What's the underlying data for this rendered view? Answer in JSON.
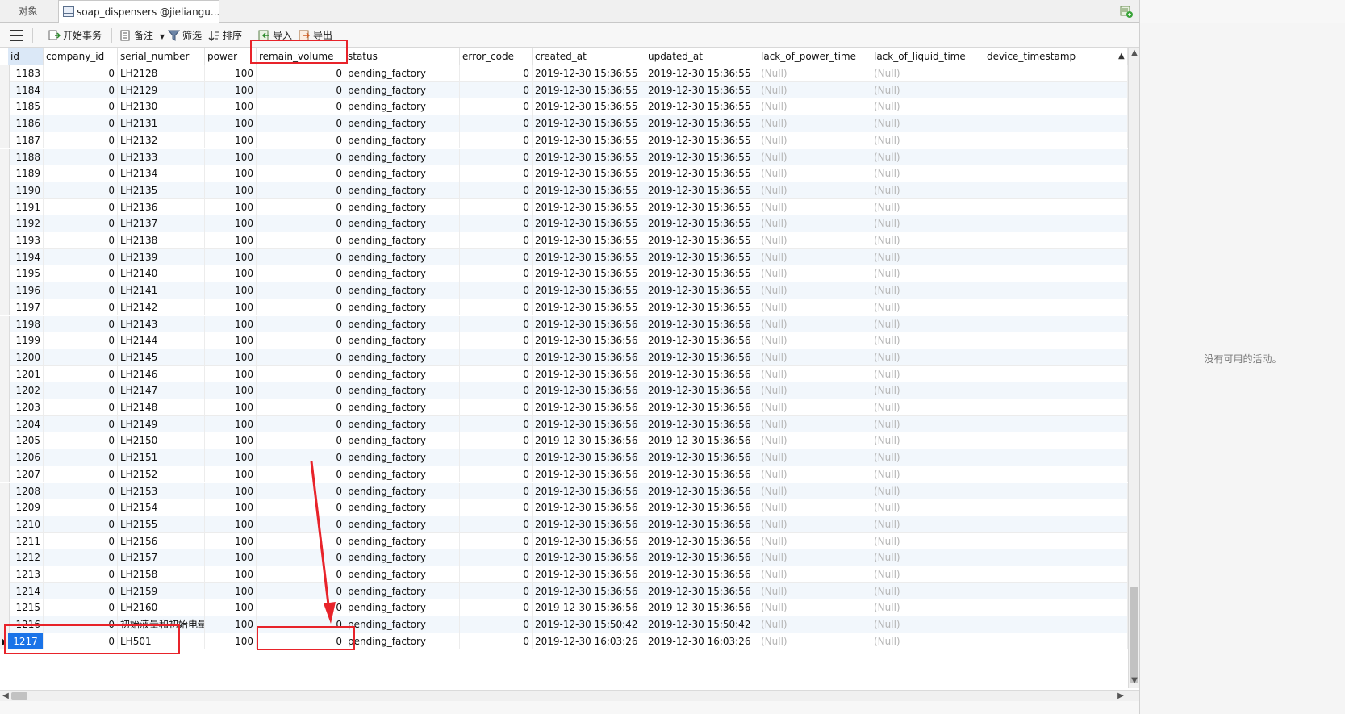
{
  "tabs": {
    "objects_label": "对象",
    "table_tab_label": "soap_dispensers @jieliangu..."
  },
  "toolbar": {
    "begin_transaction": "开始事务",
    "memo": "备注",
    "filter": "筛选",
    "sort": "排序",
    "import": "导入",
    "export": "导出"
  },
  "columns": [
    "id",
    "company_id",
    "serial_number",
    "power",
    "remain_volume",
    "status",
    "error_code",
    "created_at",
    "updated_at",
    "lack_of_power_time",
    "lack_of_liquid_time",
    "device_timestamp"
  ],
  "rows": [
    {
      "id": "1183",
      "company_id": "0",
      "serial_number": "LH2128",
      "power": "100",
      "remain_volume": "0",
      "status": "pending_factory",
      "error_code": "0",
      "created_at": "2019-12-30 15:36:55",
      "updated_at": "2019-12-30 15:36:55",
      "lack_of_power_time": "(Null)",
      "lack_of_liquid_time": "(Null)"
    },
    {
      "id": "1184",
      "company_id": "0",
      "serial_number": "LH2129",
      "power": "100",
      "remain_volume": "0",
      "status": "pending_factory",
      "error_code": "0",
      "created_at": "2019-12-30 15:36:55",
      "updated_at": "2019-12-30 15:36:55",
      "lack_of_power_time": "(Null)",
      "lack_of_liquid_time": "(Null)"
    },
    {
      "id": "1185",
      "company_id": "0",
      "serial_number": "LH2130",
      "power": "100",
      "remain_volume": "0",
      "status": "pending_factory",
      "error_code": "0",
      "created_at": "2019-12-30 15:36:55",
      "updated_at": "2019-12-30 15:36:55",
      "lack_of_power_time": "(Null)",
      "lack_of_liquid_time": "(Null)"
    },
    {
      "id": "1186",
      "company_id": "0",
      "serial_number": "LH2131",
      "power": "100",
      "remain_volume": "0",
      "status": "pending_factory",
      "error_code": "0",
      "created_at": "2019-12-30 15:36:55",
      "updated_at": "2019-12-30 15:36:55",
      "lack_of_power_time": "(Null)",
      "lack_of_liquid_time": "(Null)"
    },
    {
      "id": "1187",
      "company_id": "0",
      "serial_number": "LH2132",
      "power": "100",
      "remain_volume": "0",
      "status": "pending_factory",
      "error_code": "0",
      "created_at": "2019-12-30 15:36:55",
      "updated_at": "2019-12-30 15:36:55",
      "lack_of_power_time": "(Null)",
      "lack_of_liquid_time": "(Null)"
    },
    {
      "id": "1188",
      "company_id": "0",
      "serial_number": "LH2133",
      "power": "100",
      "remain_volume": "0",
      "status": "pending_factory",
      "error_code": "0",
      "created_at": "2019-12-30 15:36:55",
      "updated_at": "2019-12-30 15:36:55",
      "lack_of_power_time": "(Null)",
      "lack_of_liquid_time": "(Null)"
    },
    {
      "id": "1189",
      "company_id": "0",
      "serial_number": "LH2134",
      "power": "100",
      "remain_volume": "0",
      "status": "pending_factory",
      "error_code": "0",
      "created_at": "2019-12-30 15:36:55",
      "updated_at": "2019-12-30 15:36:55",
      "lack_of_power_time": "(Null)",
      "lack_of_liquid_time": "(Null)"
    },
    {
      "id": "1190",
      "company_id": "0",
      "serial_number": "LH2135",
      "power": "100",
      "remain_volume": "0",
      "status": "pending_factory",
      "error_code": "0",
      "created_at": "2019-12-30 15:36:55",
      "updated_at": "2019-12-30 15:36:55",
      "lack_of_power_time": "(Null)",
      "lack_of_liquid_time": "(Null)"
    },
    {
      "id": "1191",
      "company_id": "0",
      "serial_number": "LH2136",
      "power": "100",
      "remain_volume": "0",
      "status": "pending_factory",
      "error_code": "0",
      "created_at": "2019-12-30 15:36:55",
      "updated_at": "2019-12-30 15:36:55",
      "lack_of_power_time": "(Null)",
      "lack_of_liquid_time": "(Null)"
    },
    {
      "id": "1192",
      "company_id": "0",
      "serial_number": "LH2137",
      "power": "100",
      "remain_volume": "0",
      "status": "pending_factory",
      "error_code": "0",
      "created_at": "2019-12-30 15:36:55",
      "updated_at": "2019-12-30 15:36:55",
      "lack_of_power_time": "(Null)",
      "lack_of_liquid_time": "(Null)"
    },
    {
      "id": "1193",
      "company_id": "0",
      "serial_number": "LH2138",
      "power": "100",
      "remain_volume": "0",
      "status": "pending_factory",
      "error_code": "0",
      "created_at": "2019-12-30 15:36:55",
      "updated_at": "2019-12-30 15:36:55",
      "lack_of_power_time": "(Null)",
      "lack_of_liquid_time": "(Null)"
    },
    {
      "id": "1194",
      "company_id": "0",
      "serial_number": "LH2139",
      "power": "100",
      "remain_volume": "0",
      "status": "pending_factory",
      "error_code": "0",
      "created_at": "2019-12-30 15:36:55",
      "updated_at": "2019-12-30 15:36:55",
      "lack_of_power_time": "(Null)",
      "lack_of_liquid_time": "(Null)"
    },
    {
      "id": "1195",
      "company_id": "0",
      "serial_number": "LH2140",
      "power": "100",
      "remain_volume": "0",
      "status": "pending_factory",
      "error_code": "0",
      "created_at": "2019-12-30 15:36:55",
      "updated_at": "2019-12-30 15:36:55",
      "lack_of_power_time": "(Null)",
      "lack_of_liquid_time": "(Null)"
    },
    {
      "id": "1196",
      "company_id": "0",
      "serial_number": "LH2141",
      "power": "100",
      "remain_volume": "0",
      "status": "pending_factory",
      "error_code": "0",
      "created_at": "2019-12-30 15:36:55",
      "updated_at": "2019-12-30 15:36:55",
      "lack_of_power_time": "(Null)",
      "lack_of_liquid_time": "(Null)"
    },
    {
      "id": "1197",
      "company_id": "0",
      "serial_number": "LH2142",
      "power": "100",
      "remain_volume": "0",
      "status": "pending_factory",
      "error_code": "0",
      "created_at": "2019-12-30 15:36:55",
      "updated_at": "2019-12-30 15:36:55",
      "lack_of_power_time": "(Null)",
      "lack_of_liquid_time": "(Null)"
    },
    {
      "id": "1198",
      "company_id": "0",
      "serial_number": "LH2143",
      "power": "100",
      "remain_volume": "0",
      "status": "pending_factory",
      "error_code": "0",
      "created_at": "2019-12-30 15:36:56",
      "updated_at": "2019-12-30 15:36:56",
      "lack_of_power_time": "(Null)",
      "lack_of_liquid_time": "(Null)"
    },
    {
      "id": "1199",
      "company_id": "0",
      "serial_number": "LH2144",
      "power": "100",
      "remain_volume": "0",
      "status": "pending_factory",
      "error_code": "0",
      "created_at": "2019-12-30 15:36:56",
      "updated_at": "2019-12-30 15:36:56",
      "lack_of_power_time": "(Null)",
      "lack_of_liquid_time": "(Null)"
    },
    {
      "id": "1200",
      "company_id": "0",
      "serial_number": "LH2145",
      "power": "100",
      "remain_volume": "0",
      "status": "pending_factory",
      "error_code": "0",
      "created_at": "2019-12-30 15:36:56",
      "updated_at": "2019-12-30 15:36:56",
      "lack_of_power_time": "(Null)",
      "lack_of_liquid_time": "(Null)"
    },
    {
      "id": "1201",
      "company_id": "0",
      "serial_number": "LH2146",
      "power": "100",
      "remain_volume": "0",
      "status": "pending_factory",
      "error_code": "0",
      "created_at": "2019-12-30 15:36:56",
      "updated_at": "2019-12-30 15:36:56",
      "lack_of_power_time": "(Null)",
      "lack_of_liquid_time": "(Null)"
    },
    {
      "id": "1202",
      "company_id": "0",
      "serial_number": "LH2147",
      "power": "100",
      "remain_volume": "0",
      "status": "pending_factory",
      "error_code": "0",
      "created_at": "2019-12-30 15:36:56",
      "updated_at": "2019-12-30 15:36:56",
      "lack_of_power_time": "(Null)",
      "lack_of_liquid_time": "(Null)"
    },
    {
      "id": "1203",
      "company_id": "0",
      "serial_number": "LH2148",
      "power": "100",
      "remain_volume": "0",
      "status": "pending_factory",
      "error_code": "0",
      "created_at": "2019-12-30 15:36:56",
      "updated_at": "2019-12-30 15:36:56",
      "lack_of_power_time": "(Null)",
      "lack_of_liquid_time": "(Null)"
    },
    {
      "id": "1204",
      "company_id": "0",
      "serial_number": "LH2149",
      "power": "100",
      "remain_volume": "0",
      "status": "pending_factory",
      "error_code": "0",
      "created_at": "2019-12-30 15:36:56",
      "updated_at": "2019-12-30 15:36:56",
      "lack_of_power_time": "(Null)",
      "lack_of_liquid_time": "(Null)"
    },
    {
      "id": "1205",
      "company_id": "0",
      "serial_number": "LH2150",
      "power": "100",
      "remain_volume": "0",
      "status": "pending_factory",
      "error_code": "0",
      "created_at": "2019-12-30 15:36:56",
      "updated_at": "2019-12-30 15:36:56",
      "lack_of_power_time": "(Null)",
      "lack_of_liquid_time": "(Null)"
    },
    {
      "id": "1206",
      "company_id": "0",
      "serial_number": "LH2151",
      "power": "100",
      "remain_volume": "0",
      "status": "pending_factory",
      "error_code": "0",
      "created_at": "2019-12-30 15:36:56",
      "updated_at": "2019-12-30 15:36:56",
      "lack_of_power_time": "(Null)",
      "lack_of_liquid_time": "(Null)"
    },
    {
      "id": "1207",
      "company_id": "0",
      "serial_number": "LH2152",
      "power": "100",
      "remain_volume": "0",
      "status": "pending_factory",
      "error_code": "0",
      "created_at": "2019-12-30 15:36:56",
      "updated_at": "2019-12-30 15:36:56",
      "lack_of_power_time": "(Null)",
      "lack_of_liquid_time": "(Null)"
    },
    {
      "id": "1208",
      "company_id": "0",
      "serial_number": "LH2153",
      "power": "100",
      "remain_volume": "0",
      "status": "pending_factory",
      "error_code": "0",
      "created_at": "2019-12-30 15:36:56",
      "updated_at": "2019-12-30 15:36:56",
      "lack_of_power_time": "(Null)",
      "lack_of_liquid_time": "(Null)"
    },
    {
      "id": "1209",
      "company_id": "0",
      "serial_number": "LH2154",
      "power": "100",
      "remain_volume": "0",
      "status": "pending_factory",
      "error_code": "0",
      "created_at": "2019-12-30 15:36:56",
      "updated_at": "2019-12-30 15:36:56",
      "lack_of_power_time": "(Null)",
      "lack_of_liquid_time": "(Null)"
    },
    {
      "id": "1210",
      "company_id": "0",
      "serial_number": "LH2155",
      "power": "100",
      "remain_volume": "0",
      "status": "pending_factory",
      "error_code": "0",
      "created_at": "2019-12-30 15:36:56",
      "updated_at": "2019-12-30 15:36:56",
      "lack_of_power_time": "(Null)",
      "lack_of_liquid_time": "(Null)"
    },
    {
      "id": "1211",
      "company_id": "0",
      "serial_number": "LH2156",
      "power": "100",
      "remain_volume": "0",
      "status": "pending_factory",
      "error_code": "0",
      "created_at": "2019-12-30 15:36:56",
      "updated_at": "2019-12-30 15:36:56",
      "lack_of_power_time": "(Null)",
      "lack_of_liquid_time": "(Null)"
    },
    {
      "id": "1212",
      "company_id": "0",
      "serial_number": "LH2157",
      "power": "100",
      "remain_volume": "0",
      "status": "pending_factory",
      "error_code": "0",
      "created_at": "2019-12-30 15:36:56",
      "updated_at": "2019-12-30 15:36:56",
      "lack_of_power_time": "(Null)",
      "lack_of_liquid_time": "(Null)"
    },
    {
      "id": "1213",
      "company_id": "0",
      "serial_number": "LH2158",
      "power": "100",
      "remain_volume": "0",
      "status": "pending_factory",
      "error_code": "0",
      "created_at": "2019-12-30 15:36:56",
      "updated_at": "2019-12-30 15:36:56",
      "lack_of_power_time": "(Null)",
      "lack_of_liquid_time": "(Null)"
    },
    {
      "id": "1214",
      "company_id": "0",
      "serial_number": "LH2159",
      "power": "100",
      "remain_volume": "0",
      "status": "pending_factory",
      "error_code": "0",
      "created_at": "2019-12-30 15:36:56",
      "updated_at": "2019-12-30 15:36:56",
      "lack_of_power_time": "(Null)",
      "lack_of_liquid_time": "(Null)"
    },
    {
      "id": "1215",
      "company_id": "0",
      "serial_number": "LH2160",
      "power": "100",
      "remain_volume": "0",
      "status": "pending_factory",
      "error_code": "0",
      "created_at": "2019-12-30 15:36:56",
      "updated_at": "2019-12-30 15:36:56",
      "lack_of_power_time": "(Null)",
      "lack_of_liquid_time": "(Null)"
    },
    {
      "id": "1216",
      "company_id": "0",
      "serial_number": "初始液量和初始电量",
      "power": "100",
      "remain_volume": "0",
      "status": "pending_factory",
      "error_code": "0",
      "created_at": "2019-12-30 15:50:42",
      "updated_at": "2019-12-30 15:50:42",
      "lack_of_power_time": "(Null)",
      "lack_of_liquid_time": "(Null)"
    },
    {
      "id": "1217",
      "company_id": "0",
      "serial_number": "LH501",
      "power": "100",
      "remain_volume": "0",
      "status": "pending_factory",
      "error_code": "0",
      "created_at": "2019-12-30 16:03:26",
      "updated_at": "2019-12-30 16:03:26",
      "lack_of_power_time": "(Null)",
      "lack_of_liquid_time": "(Null)"
    }
  ],
  "selected_row_id": "1217",
  "right_panel": {
    "no_activity": "没有可用的活动。"
  },
  "colors": {
    "annotation": "#e8232a",
    "selection": "#1a73e8",
    "null_text": "#b4b4b4"
  }
}
